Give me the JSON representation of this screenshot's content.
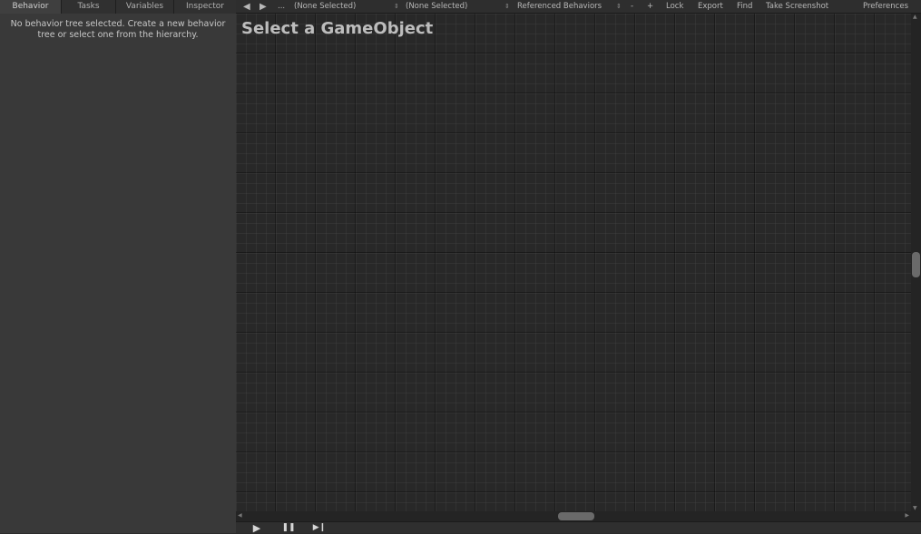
{
  "left_panel": {
    "tabs": [
      {
        "label": "Behavior",
        "active": true
      },
      {
        "label": "Tasks",
        "active": false
      },
      {
        "label": "Variables",
        "active": false
      },
      {
        "label": "Inspector",
        "active": false
      }
    ],
    "message": "No behavior tree selected. Create a new behavior tree or select one from the hierarchy."
  },
  "toolbar": {
    "back_icon": "◀",
    "forward_icon": "▶",
    "ellipsis": "...",
    "object_select": "(None Selected)",
    "behavior_select": "(None Selected)",
    "referenced_behaviors": "Referenced Behaviors",
    "remove_label": "-",
    "add_label": "+",
    "lock_label": "Lock",
    "export_label": "Export",
    "find_label": "Find",
    "screenshot_label": "Take Screenshot",
    "preferences_label": "Preferences"
  },
  "graph": {
    "title": "Select a GameObject"
  },
  "controls": {
    "play_icon": "▶",
    "pause_icon": "❚❚",
    "step_icon": "▶❙"
  },
  "colors": {
    "panel_bg": "#393939",
    "graph_bg": "#282828",
    "text": "#c4c4c4"
  }
}
